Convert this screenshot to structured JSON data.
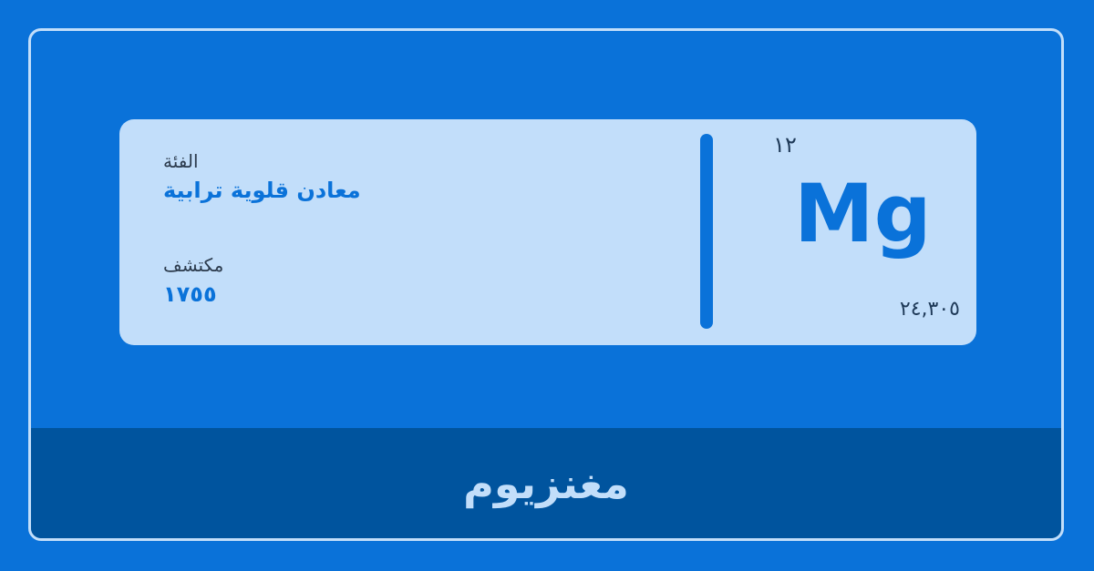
{
  "element": {
    "atomic_number": "١٢",
    "symbol": "Mg",
    "atomic_mass": "٢٤,٣٠٥",
    "name": "مغنزيوم"
  },
  "category": {
    "label": "الفئة",
    "value": "معادن قلوية ترابية"
  },
  "discoverer": {
    "label": "مكتشف",
    "value": "١٧٥٥"
  },
  "colors": {
    "background": "#0a72d9",
    "card": "#c2defa",
    "footer": "#00549e",
    "accent": "#0a72d9"
  }
}
